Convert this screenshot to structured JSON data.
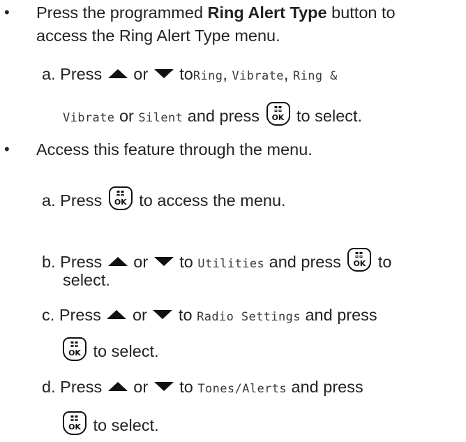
{
  "bullet_glyph": "•",
  "icons": {
    "up": "up-triangle-icon",
    "down": "down-triangle-icon",
    "ok": "menu-ok-key-icon",
    "ok_label": "OK"
  },
  "section1": {
    "line1_a": "Press the programmed ",
    "line1_bold": "Ring Alert Type",
    "line1_b": " button to",
    "line2": "access the Ring Alert Type menu.",
    "step_a": {
      "marker": "a.",
      "press": "Press",
      "or": "or",
      "to": "to",
      "opt_ring": "Ring",
      "comma1": ",",
      "opt_vibrate": "Vibrate",
      "comma2": ",",
      "opt_ring_amp": "Ring &",
      "opt_vibrate2": "Vibrate",
      "or2": "or",
      "opt_silent": "Silent",
      "and_press": "and press",
      "to_select": "to select."
    }
  },
  "section2": {
    "intro": "Access this feature through the menu.",
    "step_a": {
      "marker": "a.",
      "press": "Press",
      "rest": "to access the menu."
    },
    "step_b": {
      "marker": "b.",
      "press": "Press",
      "or": "or",
      "to": "to",
      "item": "Utilities",
      "and_press": "and press",
      "select": "select."
    },
    "step_c": {
      "marker": "c.",
      "press": "Press",
      "or": "or",
      "to": "to",
      "item": "Radio Settings",
      "and_press": "and press",
      "to_select": "to select."
    },
    "step_d": {
      "marker": "d.",
      "press": "Press",
      "or": "or",
      "to": "to",
      "item": "Tones/Alerts",
      "and_press": "and press",
      "to_select": "to select."
    }
  }
}
